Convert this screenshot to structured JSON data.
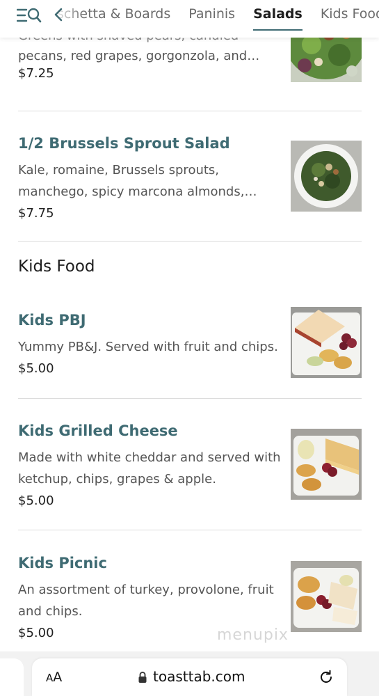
{
  "nav": {
    "tabs": [
      "schetta & Boards",
      "Paninis",
      "Salads",
      "Kids Food"
    ],
    "active_tab": "Salads"
  },
  "items": [
    {
      "title": "",
      "description": "Greens with shaved pears, candied pecans, red grapes, gorgonzola, and…",
      "desc_line1": "Greens with shaved pears, candied",
      "desc_line2": "pecans, red grapes, gorgonzola, and…",
      "price": "$7.25"
    },
    {
      "title": "1/2 Brussels Sprout Salad",
      "desc_line1": "Kale, romaine, Brussels sprouts,",
      "desc_line2": "manchego, spicy marcona almonds,…",
      "price": "$7.75"
    }
  ],
  "section": {
    "heading": "Kids Food"
  },
  "kids_items": [
    {
      "title": "Kids PBJ",
      "desc_line1": "Yummy PB&J. Served with fruit and chips.",
      "price": "$5.00"
    },
    {
      "title": "Kids Grilled Cheese",
      "desc_line1": "Made with white cheddar and served with",
      "desc_line2": "ketchup, chips, grapes & apple.",
      "price": "$5.00"
    },
    {
      "title": "Kids Picnic",
      "desc_line1": "An assortment of turkey, provolone, fruit",
      "desc_line2": "and chips.",
      "price": "$5.00"
    }
  ],
  "watermark": "menupix",
  "browser": {
    "aa_small": "A",
    "aa_large": "A",
    "url": "toasttab.com"
  },
  "colors": {
    "accent": "#3f6b73",
    "text": "#222222",
    "muted": "#555555"
  }
}
